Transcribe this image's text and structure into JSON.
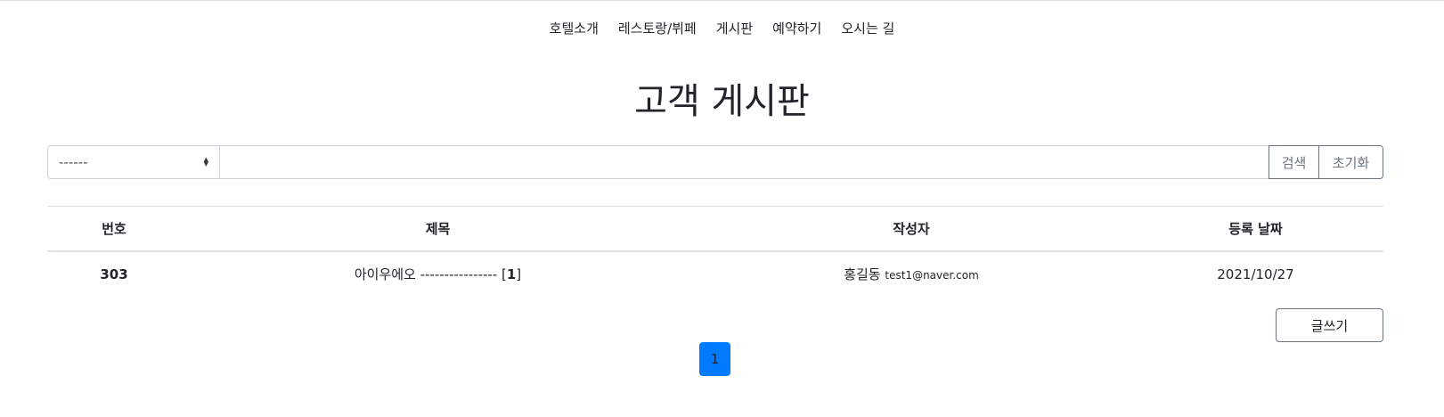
{
  "nav": {
    "items": [
      {
        "label": "호텔소개"
      },
      {
        "label": "레스토랑/뷔페"
      },
      {
        "label": "게시판"
      },
      {
        "label": "예약하기"
      },
      {
        "label": "오시는 길"
      }
    ]
  },
  "page": {
    "title": "고객 게시판"
  },
  "search": {
    "select_value": "------",
    "input_value": "",
    "search_label": "검색",
    "reset_label": "초기화"
  },
  "table": {
    "headers": {
      "number": "번호",
      "title": "제목",
      "author": "작성자",
      "date": "등록 날짜"
    },
    "rows": [
      {
        "number": "303",
        "title": "아이우에오 ----------------",
        "reply_count": "1",
        "author_name": "홍길동",
        "author_email": "test1@naver.com",
        "date": "2021/10/27"
      }
    ]
  },
  "actions": {
    "write_label": "글쓰기"
  },
  "pagination": {
    "current_page": "1",
    "active_color": "#007bff"
  }
}
